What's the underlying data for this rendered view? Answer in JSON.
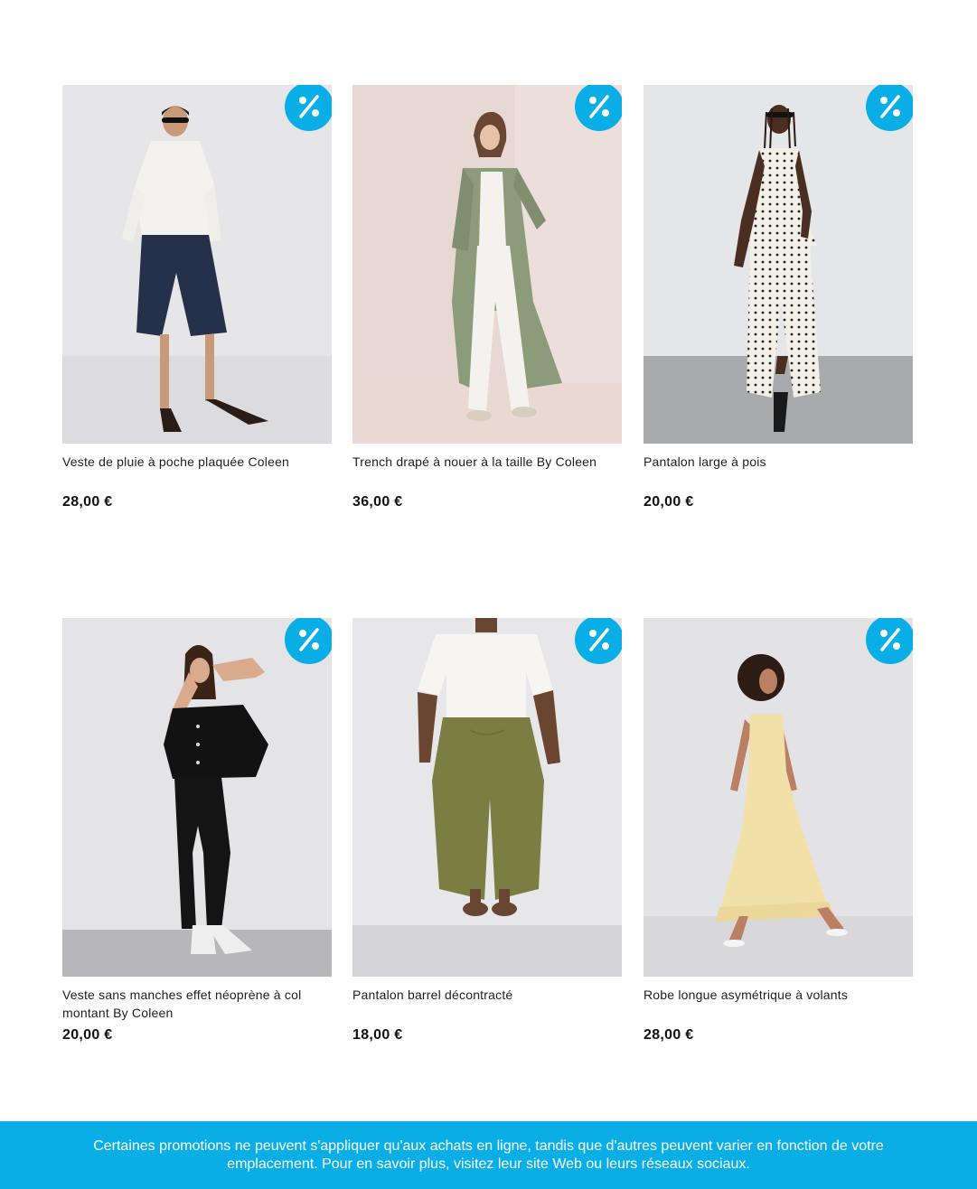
{
  "products": [
    {
      "title": "Veste de pluie à poche plaquée Coleen",
      "price": "28,00 €",
      "badge_icon": "percent-icon"
    },
    {
      "title": "Trench drapé à nouer à la taille By Coleen",
      "price": "36,00 €",
      "badge_icon": "percent-icon"
    },
    {
      "title": "Pantalon large à pois",
      "price": "20,00 €",
      "badge_icon": "percent-icon"
    },
    {
      "title": "Veste sans manches effet néoprène à col montant By Coleen",
      "price": "20,00 €",
      "badge_icon": "percent-icon"
    },
    {
      "title": "Pantalon barrel décontracté",
      "price": "18,00 €",
      "badge_icon": "percent-icon"
    },
    {
      "title": "Robe longue asymétrique à volants",
      "price": "28,00 €",
      "badge_icon": "percent-icon"
    }
  ],
  "footer": {
    "notice": "Certaines promotions ne peuvent s'appliquer qu'aux achats en ligne, tandis que d'autres peuvent varier en fonction de votre emplacement. Pour en savoir plus, visitez leur site Web ou leurs réseaux sociaux."
  },
  "colors": {
    "accent": "#0aaee6",
    "background": "#ffffff"
  }
}
